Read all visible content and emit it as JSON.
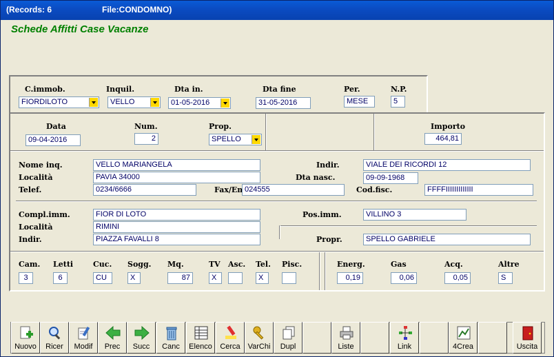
{
  "titlebar": {
    "records": "(Records: 6",
    "file": "File:CONDOMNO)"
  },
  "app_title": "Schede Affitti Case Vacanze",
  "row1": {
    "cimmob": {
      "label": "C.immob.",
      "value": "FIORDILOTO"
    },
    "inquil": {
      "label": "Inquil.",
      "value": "VELLO"
    },
    "dta_in": {
      "label": "Dta in.",
      "value": "01-05-2016"
    },
    "dta_fine": {
      "label": "Dta fine",
      "value": "31-05-2016"
    },
    "per": {
      "label": "Per.",
      "value": "MESE"
    },
    "np": {
      "label": "N.P.",
      "value": "5"
    }
  },
  "row2": {
    "data": {
      "label": "Data",
      "value": "09-04-2016"
    },
    "num": {
      "label": "Num.",
      "value": "2"
    },
    "prop": {
      "label": "Prop.",
      "value": "SPELLO"
    },
    "importo": {
      "label": "Importo",
      "value": "464,81"
    }
  },
  "inquilino": {
    "nome": {
      "label": "Nome inq.",
      "value": "VELLO MARIANGELA"
    },
    "indir": {
      "label": "Indir.",
      "value": "VIALE DEI RICORDI 12"
    },
    "localita": {
      "label": "Località",
      "value": "PAVIA  34000"
    },
    "dta_nasc": {
      "label": "Dta nasc.",
      "value": "09-09-1968"
    },
    "telef": {
      "label": "Telef.",
      "value": "0234/6666"
    },
    "fax": {
      "label": "Fax/Em",
      "value": "024555"
    },
    "codfisc": {
      "label": "Cod.fisc.",
      "value": "FFFFIIIIIIIIIIIII"
    }
  },
  "immobile": {
    "compl": {
      "label": "Compl.imm.",
      "value": "FIOR DI LOTO"
    },
    "pos": {
      "label": "Pos.imm.",
      "value": "VILLINO 3"
    },
    "localita": {
      "label": "Località",
      "value": "RIMINI"
    },
    "indir": {
      "label": "Indir.",
      "value": "PIAZZA FAVALLI 8"
    },
    "propr": {
      "label": "Propr.",
      "value": "SPELLO GABRIELE"
    }
  },
  "dotazioni": {
    "cam": {
      "label": "Cam.",
      "value": "3"
    },
    "letti": {
      "label": "Letti",
      "value": "6"
    },
    "cuc": {
      "label": "Cuc.",
      "value": "CU"
    },
    "sogg": {
      "label": "Sogg.",
      "value": "X"
    },
    "mq": {
      "label": "Mq.",
      "value": "87"
    },
    "tv": {
      "label": "TV",
      "value": "X"
    },
    "asc": {
      "label": "Asc.",
      "value": ""
    },
    "tel": {
      "label": "Tel.",
      "value": "X"
    },
    "pisc": {
      "label": "Pisc.",
      "value": ""
    },
    "energ": {
      "label": "Energ.",
      "value": "0,19"
    },
    "gas": {
      "label": "Gas",
      "value": "0,06"
    },
    "acq": {
      "label": "Acq.",
      "value": "0,05"
    },
    "altre": {
      "label": "Altre",
      "value": "S"
    }
  },
  "toolbar": {
    "nuovo": "Nuovo",
    "ricer": "Ricer",
    "modif": "Modif",
    "prec": "Prec",
    "succ": "Succ",
    "canc": "Canc",
    "elenco": "Elenco",
    "cerca": "Cerca",
    "varchi": "VarChi",
    "dupl": "Dupl",
    "liste": "Liste",
    "link": "Link",
    "crea4": "4Crea",
    "uscita": "Uscita"
  }
}
